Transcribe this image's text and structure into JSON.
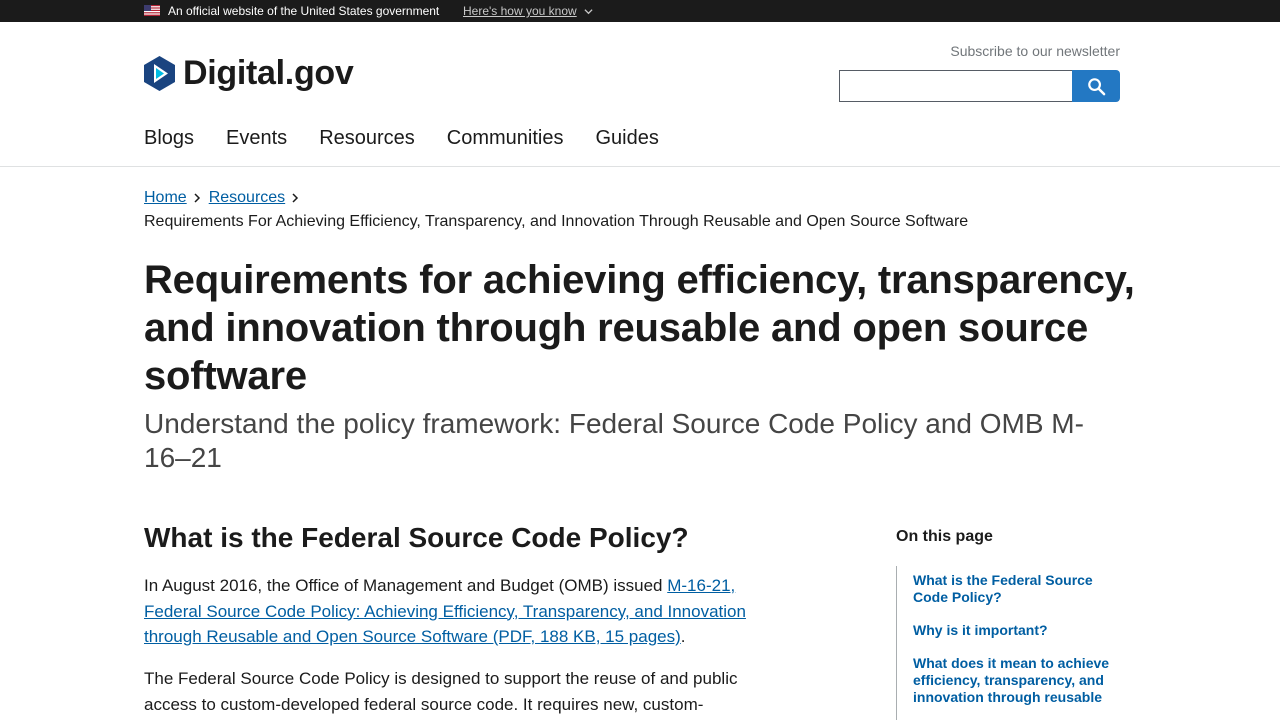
{
  "gov_banner": {
    "official_text": "An official website of the United States government",
    "how_text": "Here's how you know"
  },
  "header": {
    "logo_text": "Digital.gov",
    "subscribe_text": "Subscribe to our newsletter",
    "search_placeholder": "",
    "search_icon": "magnifier-icon",
    "accent_color": "#2378c3"
  },
  "nav": {
    "items": [
      "Blogs",
      "Events",
      "Resources",
      "Communities",
      "Guides"
    ]
  },
  "breadcrumb": {
    "home": "Home",
    "resources": "Resources",
    "current": "Requirements For Achieving Efficiency, Transparency, and Innovation Through Reusable and Open Source Software"
  },
  "page": {
    "title": "Requirements for achieving efficiency, transparency, and innovation through reusable and open source software",
    "subtitle": "Understand the policy framework: Federal Source Code Policy and OMB M-16–21"
  },
  "content": {
    "heading": "What is the Federal Source Code Policy?",
    "para1_before": "In August 2016, the Office of Management and Budget (OMB) issued ",
    "para1_link": "M-16-21, Federal Source Code Policy: Achieving Efficiency, Transparency, and Innovation through Reusable and Open Source Software (PDF, 188 KB, 15 pages)",
    "para1_after": ".",
    "para2": "The Federal Source Code Policy is designed to support the reuse of and public access to custom-developed federal source code. It requires new, custom-"
  },
  "toc": {
    "title": "On this page",
    "items": [
      "What is the Federal Source Code Policy?",
      "Why is it important?",
      "What does it mean to achieve efficiency, transparency, and innovation through reusable"
    ]
  }
}
